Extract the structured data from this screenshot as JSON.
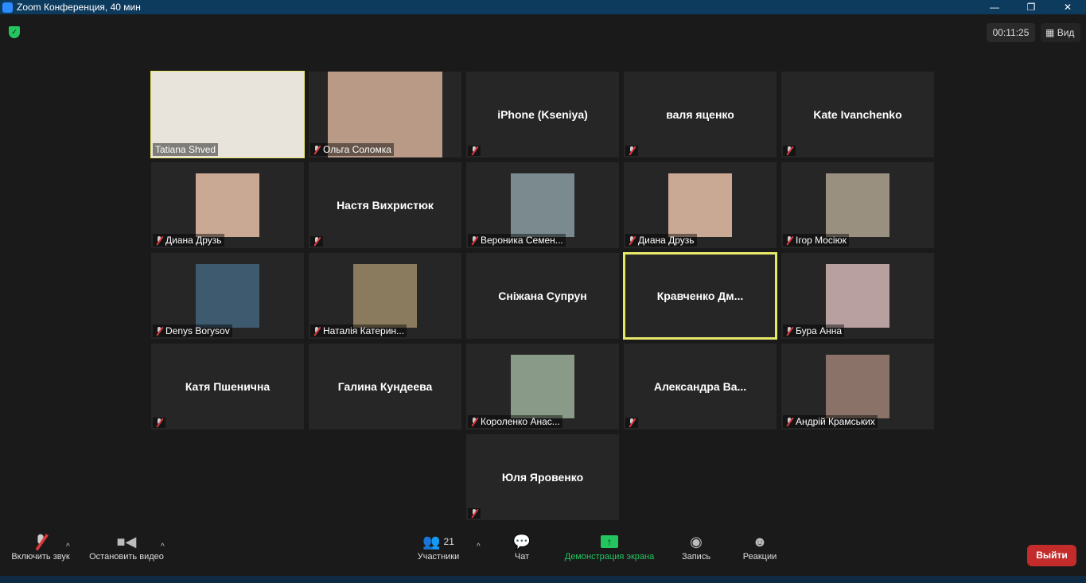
{
  "window": {
    "title": "Zoom Конференция, 40 мин",
    "minimize": "—",
    "restore": "❐",
    "close": "✕"
  },
  "header": {
    "timer": "00:11:25",
    "view_label": "Вид",
    "view_icon": "grid-icon"
  },
  "colors": {
    "highlight": "#e5e86a",
    "share": "#23c55e",
    "leave": "#c42b2b"
  },
  "tiles": [
    {
      "name": "Tatiana Shved",
      "type": "video",
      "muted": false,
      "highlight": true,
      "color": "#e8e4dc"
    },
    {
      "name": "Ольга Соломка",
      "type": "video",
      "muted": true,
      "color": "#b89a86"
    },
    {
      "name": "iPhone (Kseniya)",
      "type": "text",
      "muted": true
    },
    {
      "name": "валя яценко",
      "type": "text",
      "muted": true
    },
    {
      "name": "Kate Ivanchenko",
      "type": "text",
      "muted": true
    },
    {
      "name": "Диана Друзь",
      "type": "photo",
      "muted": true,
      "color": "#c9a894"
    },
    {
      "name": "Настя Вихристюк",
      "type": "text",
      "muted": true
    },
    {
      "name": "Вероника Семен...",
      "type": "photo",
      "muted": true,
      "color": "#7a8a8e"
    },
    {
      "name": "Диана Друзь",
      "type": "photo",
      "muted": true,
      "color": "#c9a894"
    },
    {
      "name": "Ігор Мосіюк",
      "type": "photo",
      "muted": true,
      "color": "#9a9080"
    },
    {
      "name": "Denys Borysov",
      "type": "photo",
      "muted": true,
      "color": "#3e5a6e"
    },
    {
      "name": "Наталія Катерин...",
      "type": "photo",
      "muted": true,
      "color": "#8a7a5e"
    },
    {
      "name": "Сніжана Супрун",
      "type": "text",
      "muted": false
    },
    {
      "name": "Кравченко Дм...",
      "type": "text",
      "muted": false,
      "highlight": true
    },
    {
      "name": "Бура Анна",
      "type": "photo",
      "muted": true,
      "color": "#b8a0a0"
    },
    {
      "name": "Катя Пшенична",
      "type": "text",
      "muted": true
    },
    {
      "name": "Галина Кундеева",
      "type": "text",
      "muted": false
    },
    {
      "name": "Короленко Анас...",
      "type": "photo",
      "muted": true,
      "color": "#8a9a88"
    },
    {
      "name": "Александра Ва...",
      "type": "text",
      "muted": true
    },
    {
      "name": "Андрій Крамських",
      "type": "photo",
      "muted": true,
      "color": "#8a7268"
    },
    {
      "name": "Юля Яровенко",
      "type": "text",
      "muted": true,
      "centered": true
    }
  ],
  "toolbar": {
    "unmute": "Включить звук",
    "stop_video": "Остановить видео",
    "participants": "Участники",
    "participants_count": "21",
    "chat": "Чат",
    "share": "Демонстрация экрана",
    "record": "Запись",
    "reactions": "Реакции",
    "leave": "Выйти"
  }
}
